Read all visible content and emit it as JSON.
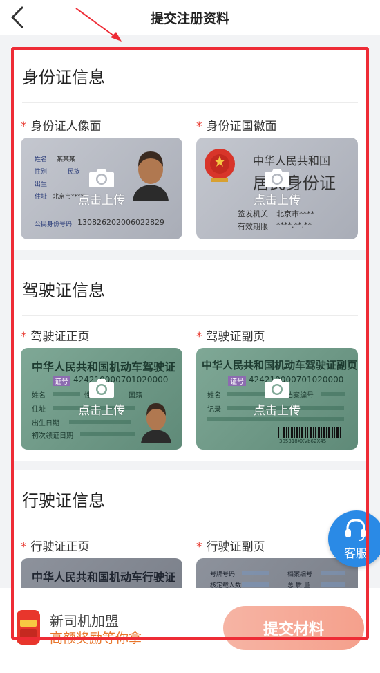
{
  "nav": {
    "title": "提交注册资料"
  },
  "common": {
    "upload_label": "点击上传",
    "required_mark": "*"
  },
  "sections": [
    {
      "title": "身份证信息",
      "cards": [
        {
          "label": "身份证人像面"
        },
        {
          "label": "身份证国徽面"
        }
      ]
    },
    {
      "title": "驾驶证信息",
      "cards": [
        {
          "label": "驾驶证正页"
        },
        {
          "label": "驾驶证副页"
        }
      ]
    },
    {
      "title": "行驶证信息",
      "cards": [
        {
          "label": "行驶证正页"
        },
        {
          "label": "行驶证副页"
        }
      ]
    }
  ],
  "id_front": {
    "name": "姓名",
    "name_val": "某某某",
    "sex": "性别",
    "nation": "民族",
    "birth": "出生",
    "addr": "住址",
    "addr_val": "北京市****",
    "number_label": "公民身份号码",
    "number": "130826202006022829"
  },
  "id_back": {
    "line1": "中华人民共和国",
    "line2": "居民身份证",
    "authority": "签发机关",
    "authority_val": "北京市****",
    "valid": "有效期限",
    "valid_val": "****.**.**"
  },
  "license_front": {
    "title": "中华人民共和国机动车驾驶证",
    "badge": "证号",
    "number": "424210000701020000",
    "name": "姓名",
    "sex": "性别",
    "nationality": "国籍",
    "addr": "住址",
    "birth": "出生日期",
    "first": "初次领证日期"
  },
  "license_back": {
    "title": "中华人民共和国机动车驾驶证副页",
    "badge": "证号",
    "number": "424210000701020000",
    "name": "姓名",
    "file": "档案编号",
    "record": "记录",
    "barcode_text": "305318XXVb62X45"
  },
  "vehicle_front": {
    "title": "中华人民共和国机动车行驶证"
  },
  "vehicle_back": {
    "plate": "号牌号码",
    "file": "档案编号",
    "passengers": "核定载人数",
    "mass": "总 质 量"
  },
  "bottom": {
    "line1": "新司机加盟",
    "line2": "高额奖励等你拿",
    "submit": "提交材料"
  },
  "service": {
    "label": "客服"
  },
  "colors": {
    "accent": "#ee2c36",
    "service": "#2a8ae6",
    "submit": "#f5a08c",
    "promo": "#e8762c"
  }
}
